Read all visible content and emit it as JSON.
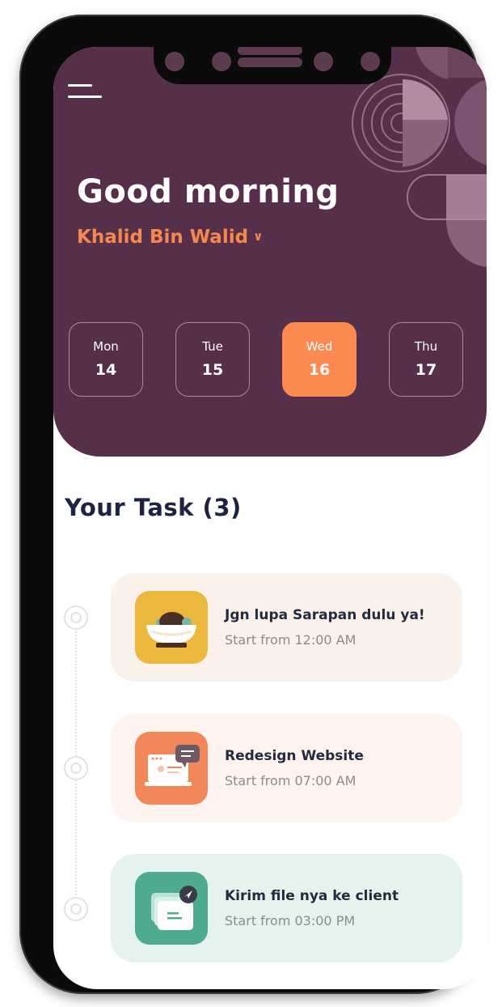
{
  "header": {
    "greeting": "Good morning",
    "user_name": "Khalid Bin Walid",
    "menu_icon": "hamburger-menu-icon",
    "dropdown_icon": "chevron-down-icon"
  },
  "days": [
    {
      "name": "Mon",
      "date": "14",
      "selected": false
    },
    {
      "name": "Tue",
      "date": "15",
      "selected": false
    },
    {
      "name": "Wed",
      "date": "16",
      "selected": true
    },
    {
      "name": "Thu",
      "date": "17",
      "selected": false
    }
  ],
  "tasks_section": {
    "title": "Your Task  (3)"
  },
  "tasks": [
    {
      "title": "Jgn lupa Sarapan dulu ya!",
      "time": "Start from 12:00 AM",
      "icon": "food-bowl-icon",
      "card_color": "#faf2ea",
      "icon_color": "#ebb73c"
    },
    {
      "title": "Redesign Website",
      "time": "Start from 07:00 AM",
      "icon": "laptop-chat-icon",
      "card_color": "#fef3ef",
      "icon_color": "#f2885a"
    },
    {
      "title": "Kirim file nya ke client",
      "time": "Start from 03:00 PM",
      "icon": "send-file-icon",
      "card_color": "#e4f3ee",
      "icon_color": "#4fab90"
    }
  ],
  "colors": {
    "header_bg": "#56304a",
    "accent": "#fd8a51",
    "title_text": "#1e2343"
  }
}
